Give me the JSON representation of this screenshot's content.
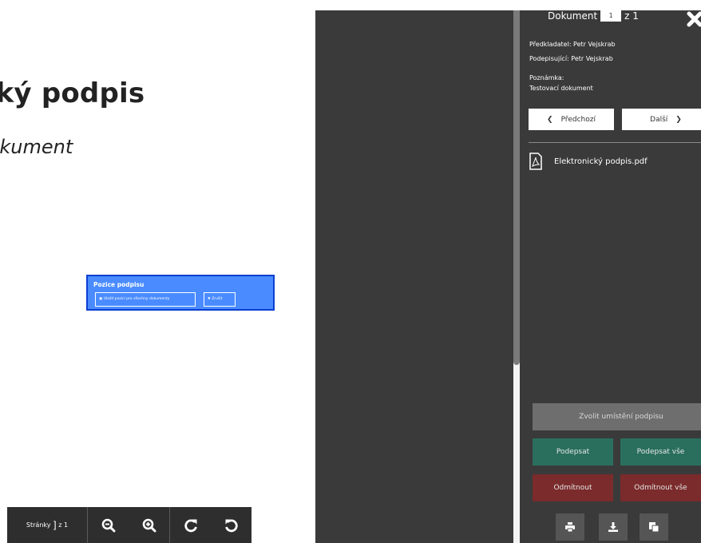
{
  "document": {
    "title": "nický podpis",
    "subtitle": "cí dokument"
  },
  "signature_box": {
    "title": "Pozice podpisu",
    "save_label": "Uložit pozici pro všechny dokumenty",
    "cancel_label": "Zrušit"
  },
  "viewer_toolbar": {
    "pages_label": "Stránky",
    "pages_current": "]",
    "pages_total": "z 1"
  },
  "panel": {
    "doc_label": "Dokument",
    "doc_current": "1",
    "doc_total": "z 1",
    "submitter": "Předkladatel: Petr Vejskrab",
    "signer": "Podepisující: Petr Vejskrab",
    "note_label": "Poznámka:",
    "note_value": "Testovací dokument",
    "prev_label": "Předchozí",
    "next_label": "Další",
    "file_name": "Elektronický podpis.pdf",
    "place_label": "Zvolit umístění podpisu",
    "sign_label": "Podepsat",
    "sign_all_label": "Podepsat vše",
    "reject_label": "Odmítnout",
    "reject_all_label": "Odmítnout vše"
  },
  "colors": {
    "sign_green": "#2a6f5e",
    "reject_red": "#7b2b2b",
    "panel_bg": "#3a3a3a",
    "sig_box_blue": "#4a8cff"
  }
}
